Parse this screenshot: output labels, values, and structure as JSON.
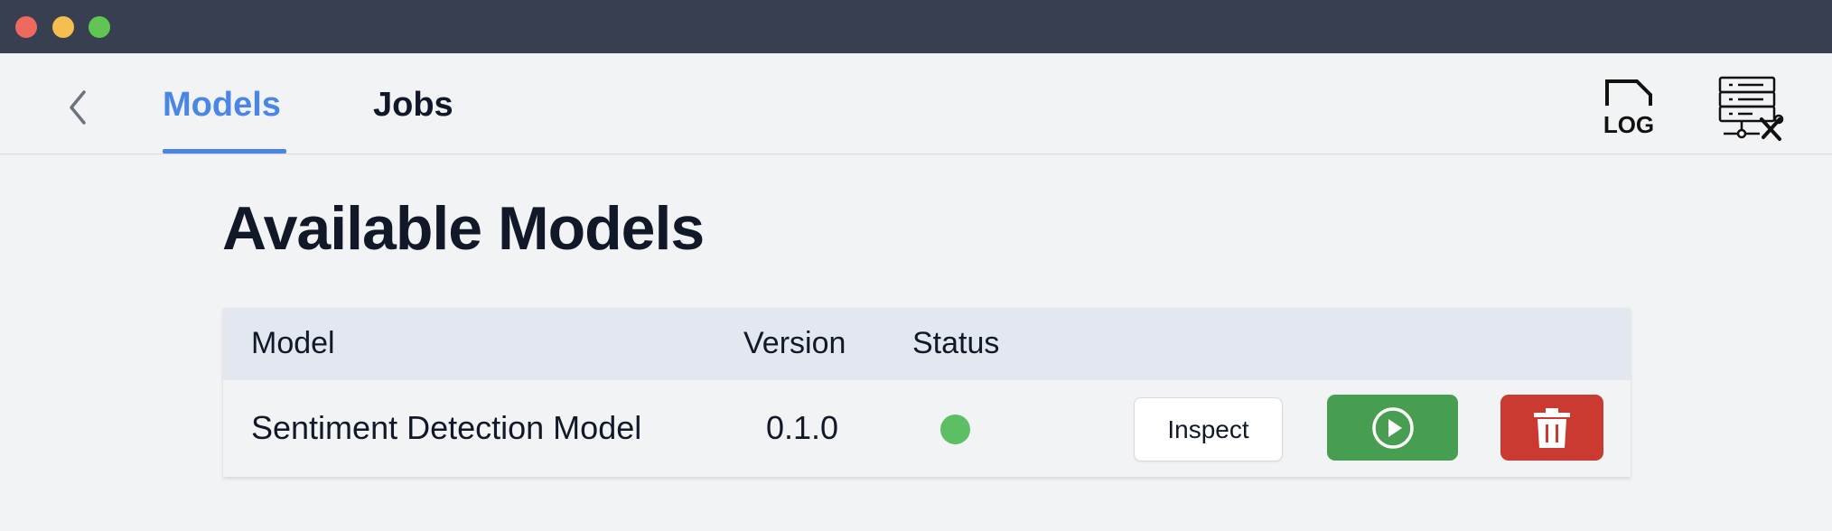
{
  "window": {
    "controls": [
      "close",
      "minimize",
      "maximize"
    ],
    "colors": {
      "close": "#ee6a5f",
      "minimize": "#f5bf4f",
      "maximize": "#61c554",
      "titlebar": "#383f51"
    }
  },
  "nav": {
    "back_icon": "chevron-left-icon",
    "tabs": [
      {
        "label": "Models",
        "active": true
      },
      {
        "label": "Jobs",
        "active": false
      }
    ],
    "active_color": "#4a86e8",
    "log_icon_label": "LOG",
    "log_icon": "log-file-icon",
    "server_icon": "server-settings-icon"
  },
  "main": {
    "title": "Available Models",
    "table": {
      "columns": [
        "Model",
        "Version",
        "Status"
      ],
      "rows": [
        {
          "model": "Sentiment Detection Model",
          "version": "0.1.0",
          "status": "active",
          "status_color": "#5cbf63",
          "inspect_label": "Inspect",
          "run_icon": "play-icon",
          "run_color": "#489e50",
          "delete_icon": "trash-icon",
          "delete_color": "#cb3a31"
        }
      ]
    }
  }
}
